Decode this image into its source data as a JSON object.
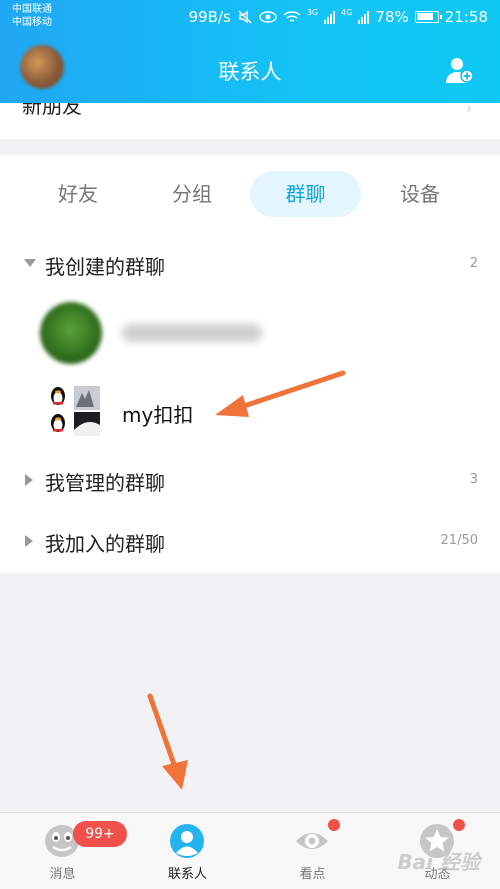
{
  "status_bar": {
    "carrier_1": "中国联通",
    "carrier_2": "中国移动",
    "speed": "99B/s",
    "net_3g": "3G",
    "net_4g": "4G",
    "battery": "78%",
    "time": "21:58"
  },
  "header": {
    "title": "联系人"
  },
  "partial_row": {
    "label": "新朋友"
  },
  "tabs": [
    {
      "label": "好友"
    },
    {
      "label": "分组"
    },
    {
      "label": "群聊",
      "active": true
    },
    {
      "label": "设备"
    }
  ],
  "groups": {
    "created": {
      "label": "我创建的群聊",
      "count": "2",
      "rows": [
        {
          "name": ""
        },
        {
          "name": "my扣扣"
        }
      ]
    },
    "managed": {
      "label": "我管理的群聊",
      "count": "3"
    },
    "joined": {
      "label": "我加入的群聊",
      "count": "21/50"
    }
  },
  "bottom_nav": [
    {
      "label": "消息",
      "badge": "99+"
    },
    {
      "label": "联系人",
      "active": true
    },
    {
      "label": "看点"
    },
    {
      "label": "动态"
    }
  ],
  "watermark": "Bai 经验",
  "colors": {
    "header_start": "#20a7f3",
    "header_end": "#0ec9f3",
    "active_tab_bg": "#e3f6fd",
    "active_tab_text": "#11a3d8",
    "arrow": "#f0743a",
    "badge": "#f2504b"
  }
}
